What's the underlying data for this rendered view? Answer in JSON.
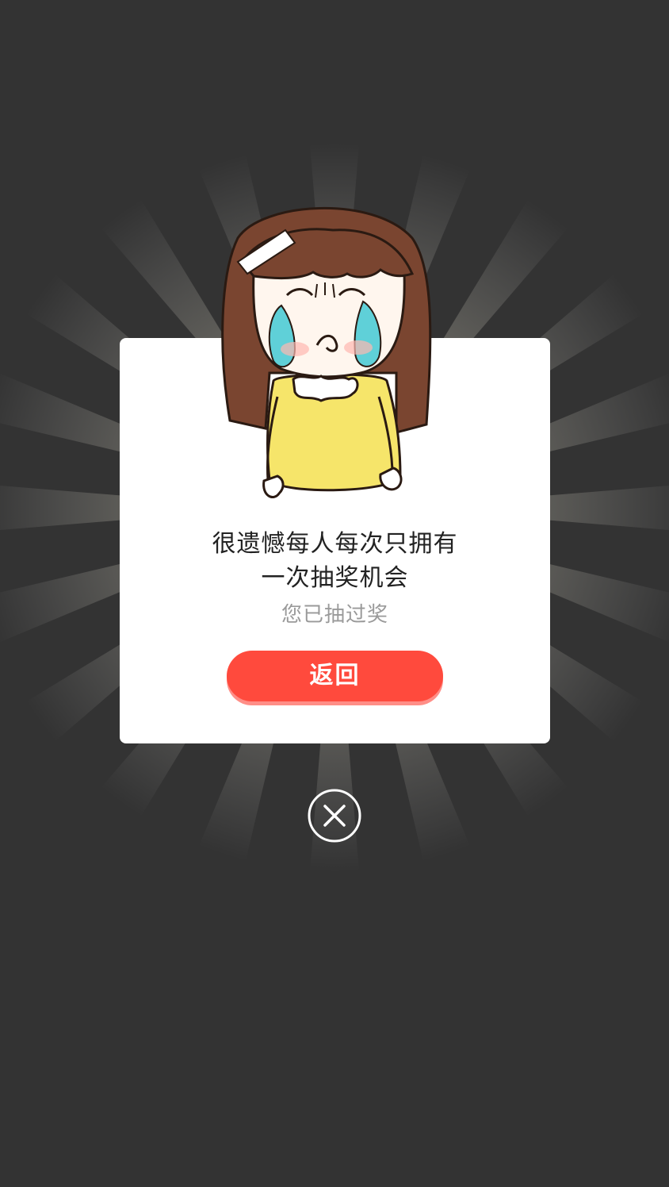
{
  "dialog": {
    "message_line1": "很遗憾每人每次只拥有",
    "message_line2": "一次抽奖机会",
    "subtext": "您已抽过奖",
    "button_label": "返回"
  },
  "icons": {
    "close": "close-icon",
    "illustration": "crying-girl-illustration"
  },
  "colors": {
    "background": "#333333",
    "button": "#ff4a3d",
    "button_shadow": "#ff8e87",
    "card": "#ffffff",
    "hair": "#7a4530",
    "shirt": "#f6e56a",
    "tears": "#5fd0d8"
  }
}
